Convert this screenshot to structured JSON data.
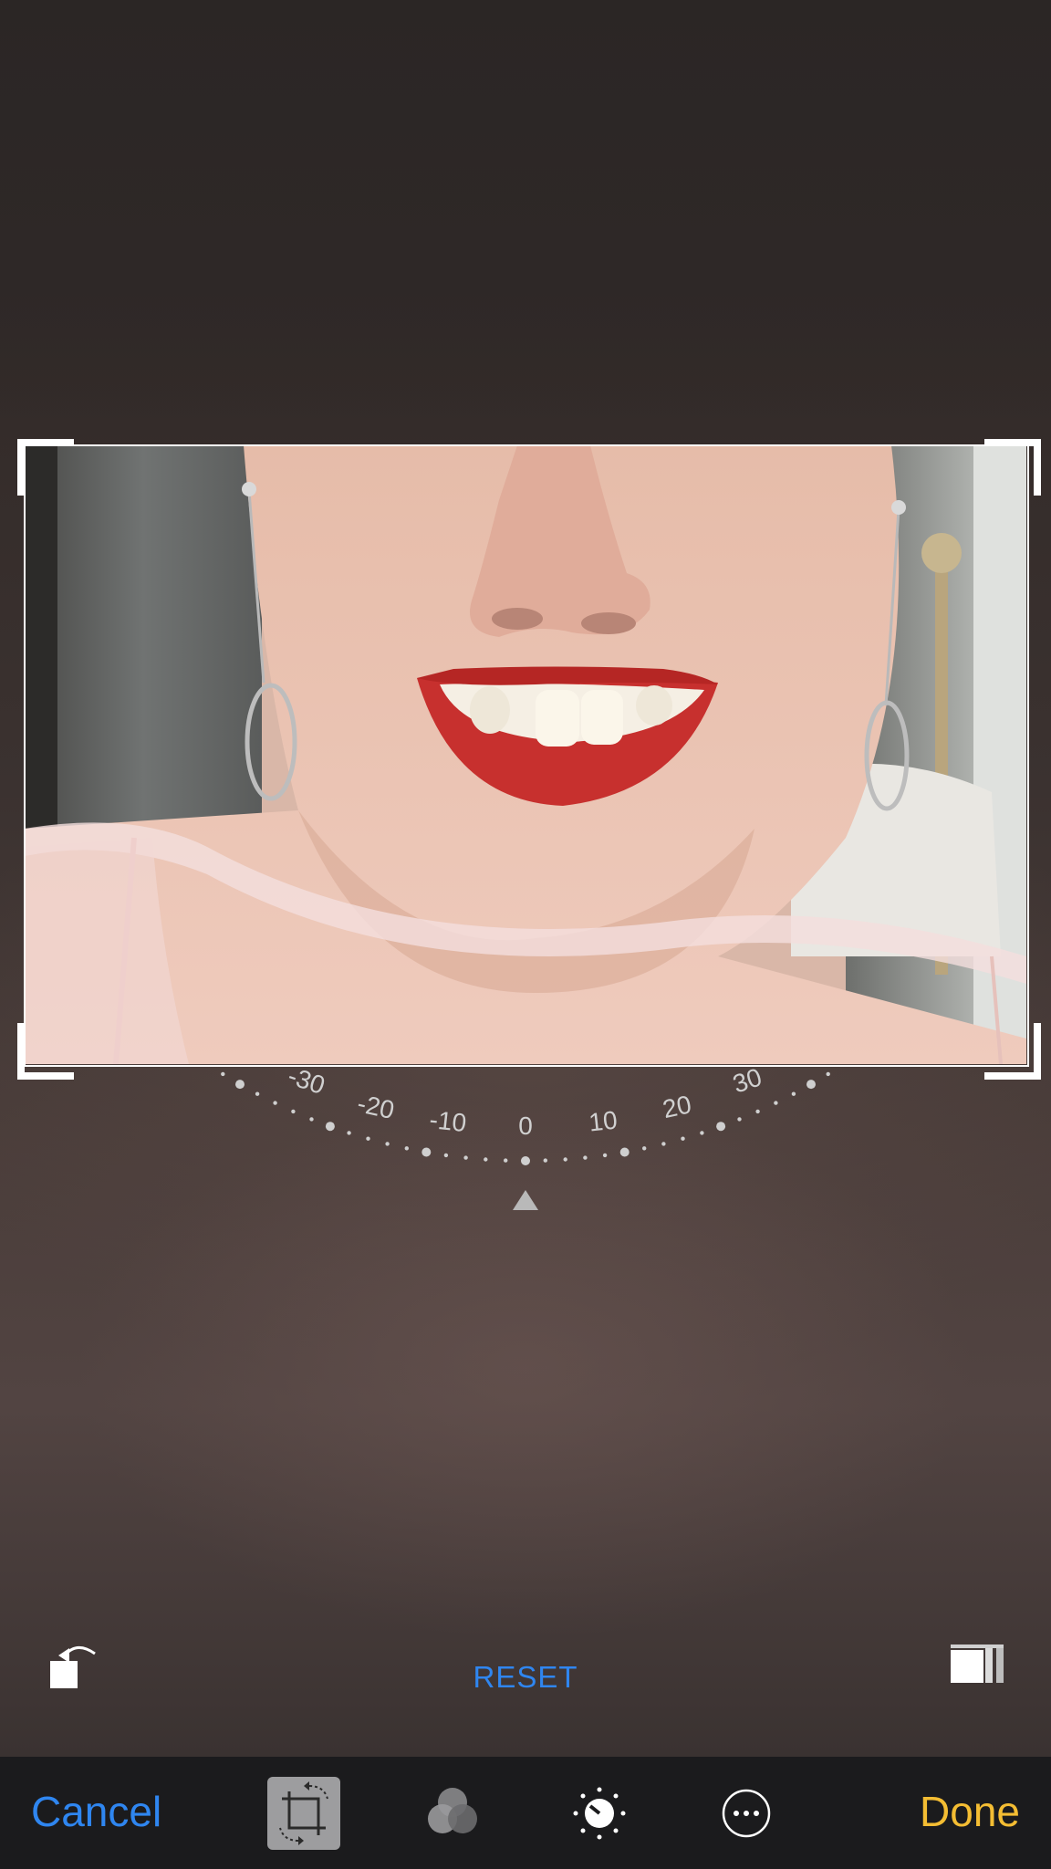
{
  "editor": {
    "reset_label": "RESET",
    "cancel_label": "Cancel",
    "done_label": "Done"
  },
  "dial": {
    "labels": [
      "-30",
      "-20",
      "-10",
      "0",
      "10",
      "20",
      "30"
    ],
    "selected_value": "0"
  },
  "toolbar": {
    "tools": [
      "crop-rotate-icon",
      "filters-icon",
      "adjust-icon",
      "more-icon"
    ],
    "active_tool": "crop-rotate-icon"
  },
  "colors": {
    "accent_blue": "#2f86f0",
    "done_yellow": "#f4bd33",
    "toolbar_bg": "#1b1b1d"
  }
}
